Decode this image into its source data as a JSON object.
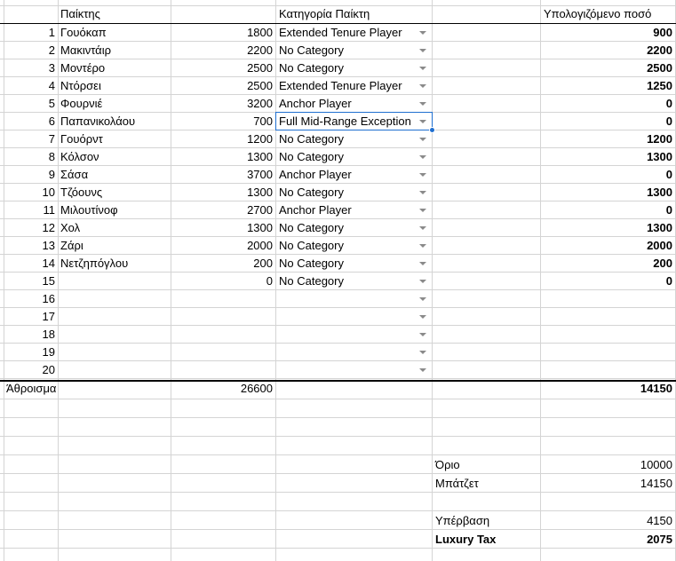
{
  "headers": {
    "player": "Παίκτης",
    "category": "Κατηγορία Παίκτη",
    "computed": "Υπολογιζόμενο ποσό"
  },
  "rows": [
    {
      "n": "1",
      "name": "Γουόκαπ",
      "salary": "1800",
      "category": "Extended Tenure Player",
      "computed": "900"
    },
    {
      "n": "2",
      "name": "Μακιντάιρ",
      "salary": "2200",
      "category": "No Category",
      "computed": "2200"
    },
    {
      "n": "3",
      "name": "Μοντέρο",
      "salary": "2500",
      "category": "No Category",
      "computed": "2500"
    },
    {
      "n": "4",
      "name": "Ντόρσει",
      "salary": "2500",
      "category": "Extended Tenure Player",
      "computed": "1250"
    },
    {
      "n": "5",
      "name": "Φουρνιέ",
      "salary": "3200",
      "category": "Anchor Player",
      "computed": "0"
    },
    {
      "n": "6",
      "name": "Παπανικολάου",
      "salary": "700",
      "category": "Full Mid-Range Exception",
      "computed": "0"
    },
    {
      "n": "7",
      "name": "Γουόρντ",
      "salary": "1200",
      "category": "No Category",
      "computed": "1200"
    },
    {
      "n": "8",
      "name": "Κόλσον",
      "salary": "1300",
      "category": "No Category",
      "computed": "1300"
    },
    {
      "n": "9",
      "name": "Σάσα",
      "salary": "3700",
      "category": "Anchor Player",
      "computed": "0"
    },
    {
      "n": "10",
      "name": "Τζόουνς",
      "salary": "1300",
      "category": "No Category",
      "computed": "1300"
    },
    {
      "n": "11",
      "name": "Μιλουτίνοφ",
      "salary": "2700",
      "category": "Anchor Player",
      "computed": "0"
    },
    {
      "n": "12",
      "name": "Χολ",
      "salary": "1300",
      "category": "No Category",
      "computed": "1300"
    },
    {
      "n": "13",
      "name": "Ζάρι",
      "salary": "2000",
      "category": "No Category",
      "computed": "2000"
    },
    {
      "n": "14",
      "name": "Νετζηπόγλου",
      "salary": "200",
      "category": "No Category",
      "computed": "200"
    },
    {
      "n": "15",
      "name": "",
      "salary": "0",
      "category": "No Category",
      "computed": "0"
    },
    {
      "n": "16",
      "name": "",
      "salary": "",
      "category": "",
      "computed": ""
    },
    {
      "n": "17",
      "name": "",
      "salary": "",
      "category": "",
      "computed": ""
    },
    {
      "n": "18",
      "name": "",
      "salary": "",
      "category": "",
      "computed": ""
    },
    {
      "n": "19",
      "name": "",
      "salary": "",
      "category": "",
      "computed": ""
    },
    {
      "n": "20",
      "name": "",
      "salary": "",
      "category": "",
      "computed": ""
    }
  ],
  "totals": {
    "label": "Άθροισμα",
    "salary": "26600",
    "computed": "14150"
  },
  "summary": {
    "limit_label": "Όριο",
    "limit_value": "10000",
    "budget_label": "Μπάτζετ",
    "budget_value": "14150",
    "excess_label": "Υπέρβαση",
    "excess_value": "4150",
    "tax_label": "Luxury Tax",
    "tax_value": "2075"
  },
  "selected_row_index": 5,
  "colors": {
    "selection": "#1f6fd0",
    "grid": "#d4d4d4"
  }
}
